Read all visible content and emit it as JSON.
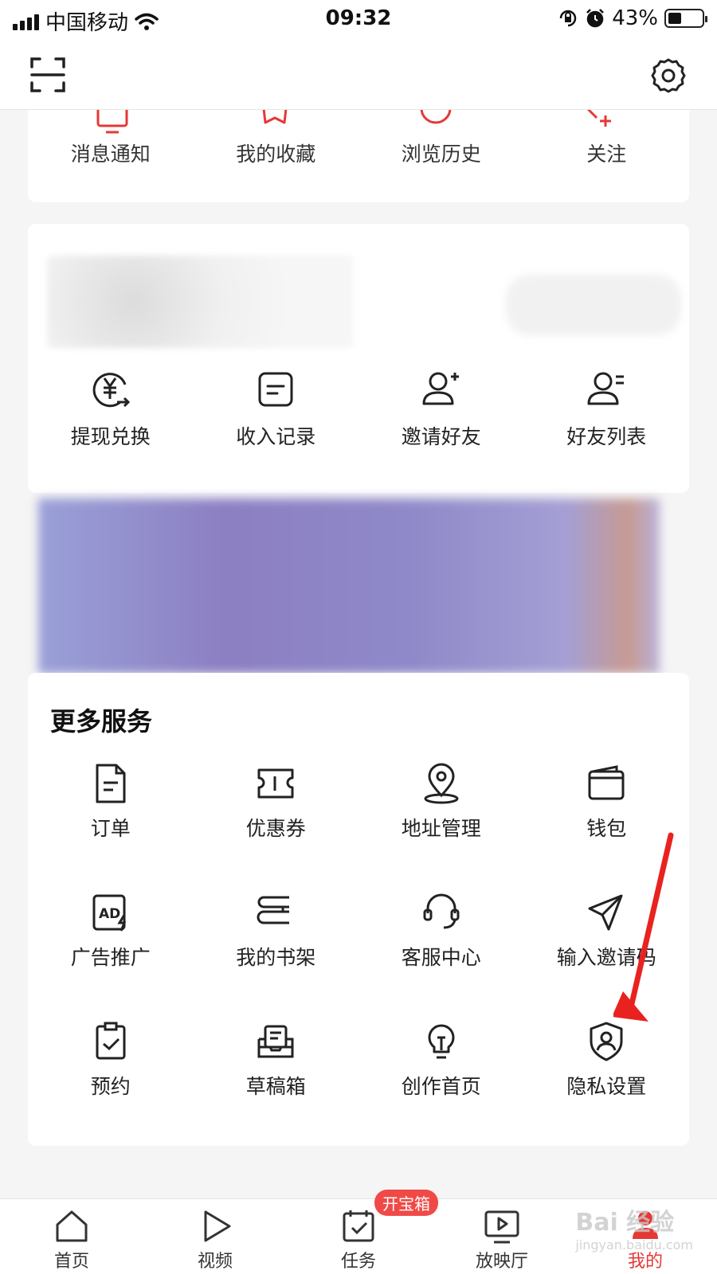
{
  "status_bar": {
    "carrier": "中国移动",
    "time": "09:32",
    "battery": "43%"
  },
  "quick_actions": [
    {
      "label": "消息通知",
      "icon": "message-icon"
    },
    {
      "label": "我的收藏",
      "icon": "star-icon"
    },
    {
      "label": "浏览历史",
      "icon": "history-icon"
    },
    {
      "label": "关注",
      "icon": "follow-icon"
    }
  ],
  "earnings": [
    {
      "label": "提现兑换",
      "icon": "yuan-exchange-icon"
    },
    {
      "label": "收入记录",
      "icon": "record-icon"
    },
    {
      "label": "邀请好友",
      "icon": "invite-friend-icon"
    },
    {
      "label": "好友列表",
      "icon": "friend-list-icon"
    }
  ],
  "more_services": {
    "title": "更多服务",
    "items": [
      {
        "label": "订单",
        "icon": "order-icon"
      },
      {
        "label": "优惠券",
        "icon": "coupon-icon"
      },
      {
        "label": "地址管理",
        "icon": "location-icon"
      },
      {
        "label": "钱包",
        "icon": "wallet-icon"
      },
      {
        "label": "广告推广",
        "icon": "ad-icon"
      },
      {
        "label": "我的书架",
        "icon": "bookshelf-icon"
      },
      {
        "label": "客服中心",
        "icon": "headset-icon"
      },
      {
        "label": "输入邀请码",
        "icon": "paper-plane-icon"
      },
      {
        "label": "预约",
        "icon": "clipboard-check-icon"
      },
      {
        "label": "草稿箱",
        "icon": "drafts-icon"
      },
      {
        "label": "创作首页",
        "icon": "lightbulb-icon"
      },
      {
        "label": "隐私设置",
        "icon": "privacy-shield-icon"
      }
    ]
  },
  "tabbar": {
    "tabs": [
      {
        "label": "首页",
        "icon": "home-icon"
      },
      {
        "label": "视频",
        "icon": "play-icon"
      },
      {
        "label": "任务",
        "icon": "task-icon",
        "badge": "开宝箱"
      },
      {
        "label": "放映厅",
        "icon": "theater-icon"
      },
      {
        "label": "我的",
        "icon": "profile-icon",
        "active": true
      }
    ]
  },
  "watermark": {
    "brand": "Bai 经验",
    "url": "jingyan.baidu.com"
  },
  "colors": {
    "accent": "#e53935",
    "badge": "#f04a48",
    "arrow": "#e8231f"
  }
}
